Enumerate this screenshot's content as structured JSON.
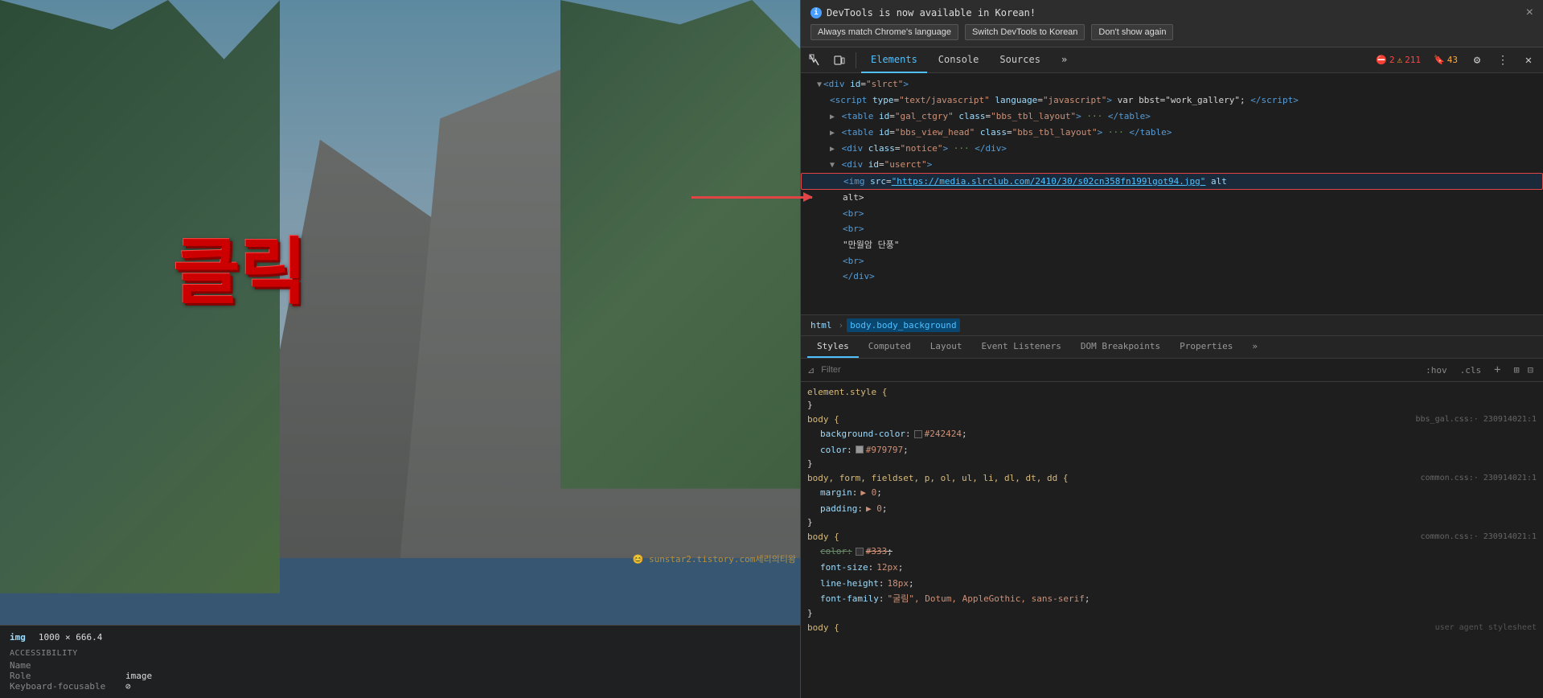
{
  "devtools": {
    "notification": {
      "title": "DevTools is now available in Korean!",
      "btn_match": "Always match Chrome's language",
      "btn_switch": "Switch DevTools to Korean",
      "btn_dont_show": "Don't show again"
    },
    "toolbar": {
      "tabs": [
        "Elements",
        "Console",
        "Sources"
      ],
      "more_label": "»",
      "error_count": "2",
      "warn_count": "211",
      "bookmark_count": "43"
    },
    "breadcrumb": {
      "items": [
        "html",
        "body.body_background"
      ]
    },
    "style_tabs": {
      "tabs": [
        "Styles",
        "Computed",
        "Layout",
        "Event Listeners",
        "DOM Breakpoints",
        "Properties",
        "»"
      ]
    },
    "filter": {
      "placeholder": "Filter",
      "hov_label": ":hov",
      "cls_label": ".cls"
    },
    "dom_tree": {
      "lines": [
        {
          "indent": 1,
          "content": "<div id=\"slrct\">"
        },
        {
          "indent": 2,
          "content": "<script type=\"text/javascript\" language=\"javascript\"> var bbst=\"work_gallery\"; <\\/script>"
        },
        {
          "indent": 2,
          "content": "▶ <table id=\"gal_ctgry\" class=\"bbs_tbl_layout\"> ··· <\\/table>"
        },
        {
          "indent": 2,
          "content": "▶ <table id=\"bbs_view_head\" class=\"bbs_tbl_layout\"> ··· <\\/table>"
        },
        {
          "indent": 2,
          "content": "▶ <div class=\"notice\"> ··· <\\/div>"
        },
        {
          "indent": 2,
          "content": "▼ <div id=\"userct\">"
        },
        {
          "indent": 3,
          "content": "<img src=\"https://media.slrclub.com/2410/30/s02cn358fn199lgot94.jpg\" alt"
        },
        {
          "indent": 3,
          "content": "alt>"
        },
        {
          "indent": 3,
          "content": "<br>"
        },
        {
          "indent": 3,
          "content": "<br>"
        },
        {
          "indent": 3,
          "content": "\"만월암 단풍\""
        },
        {
          "indent": 3,
          "content": "<br>"
        },
        {
          "indent": 3,
          "content": "<\\/div>"
        }
      ],
      "highlighted_line_idx": 6
    },
    "css_rules": [
      {
        "selector": "element.style {",
        "close": "}",
        "source": "",
        "properties": []
      },
      {
        "selector": "body {",
        "close": "}",
        "source": "bbs_gal.css:· 230914021:1",
        "properties": [
          {
            "prop": "background-color",
            "value": "#242424",
            "color_swatch": "#242424"
          },
          {
            "prop": "color",
            "value": "#979797",
            "color_swatch": "#979797"
          }
        ]
      },
      {
        "selector": "body, form, fieldset, p, ol, ul, li, dl, dt, dd {",
        "close": "}",
        "source": "common.css:· 230914021:1",
        "properties": [
          {
            "prop": "margin",
            "value": "▶ 0;"
          },
          {
            "prop": "padding",
            "value": "▶ 0;"
          }
        ]
      },
      {
        "selector": "body {",
        "close": "}",
        "source": "common.css:· 230914021:1",
        "properties": [
          {
            "prop": "color+",
            "value": "#333;",
            "color_swatch": "#333333"
          },
          {
            "prop": "font-size",
            "value": "12px;"
          },
          {
            "prop": "line-height",
            "value": "18px;"
          },
          {
            "prop": "font-family",
            "value": "\"굴림\", Dotum, AppleGothic, sans-serif;"
          }
        ]
      }
    ]
  },
  "webpage": {
    "click_text": "클릭",
    "element_info": {
      "type": "img",
      "dimensions": "1000 × 666.4"
    },
    "accessibility": {
      "title": "ACCESSIBILITY",
      "name_label": "Name",
      "name_value": "",
      "role_label": "Role",
      "role_value": "image",
      "keyboard_label": "Keyboard-focusable",
      "keyboard_value": "⊘"
    },
    "watermark": "😊 sunstar2.tistory.com세리의티왕"
  }
}
